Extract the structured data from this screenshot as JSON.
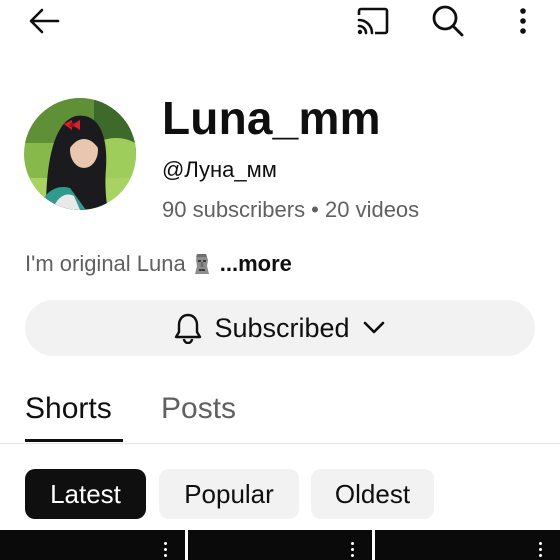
{
  "header": {
    "back_icon": "arrow-left-icon",
    "cast_icon": "cast-icon",
    "search_icon": "search-icon",
    "more_icon": "more-vertical-icon"
  },
  "channel": {
    "name": "Luna_mm",
    "handle": "@Луна_мм",
    "stats": "90 subscribers • 20 videos",
    "description": "I'm original Luna",
    "description_emoji": "moai-emoji",
    "more_label": "...more"
  },
  "subscribe": {
    "label": "Subscribed",
    "bell_icon": "bell-icon",
    "chevron_icon": "chevron-down-icon"
  },
  "tabs": [
    {
      "label": "Shorts",
      "selected": true
    },
    {
      "label": "Posts",
      "selected": false
    }
  ],
  "chips": [
    {
      "label": "Latest",
      "selected": true
    },
    {
      "label": "Popular",
      "selected": false
    },
    {
      "label": "Oldest",
      "selected": false
    }
  ],
  "colors": {
    "text_primary": "#0f0f0f",
    "text_secondary": "#606060",
    "chip_background": "#f2f2f2",
    "chip_selected_background": "#0f0f0f"
  }
}
